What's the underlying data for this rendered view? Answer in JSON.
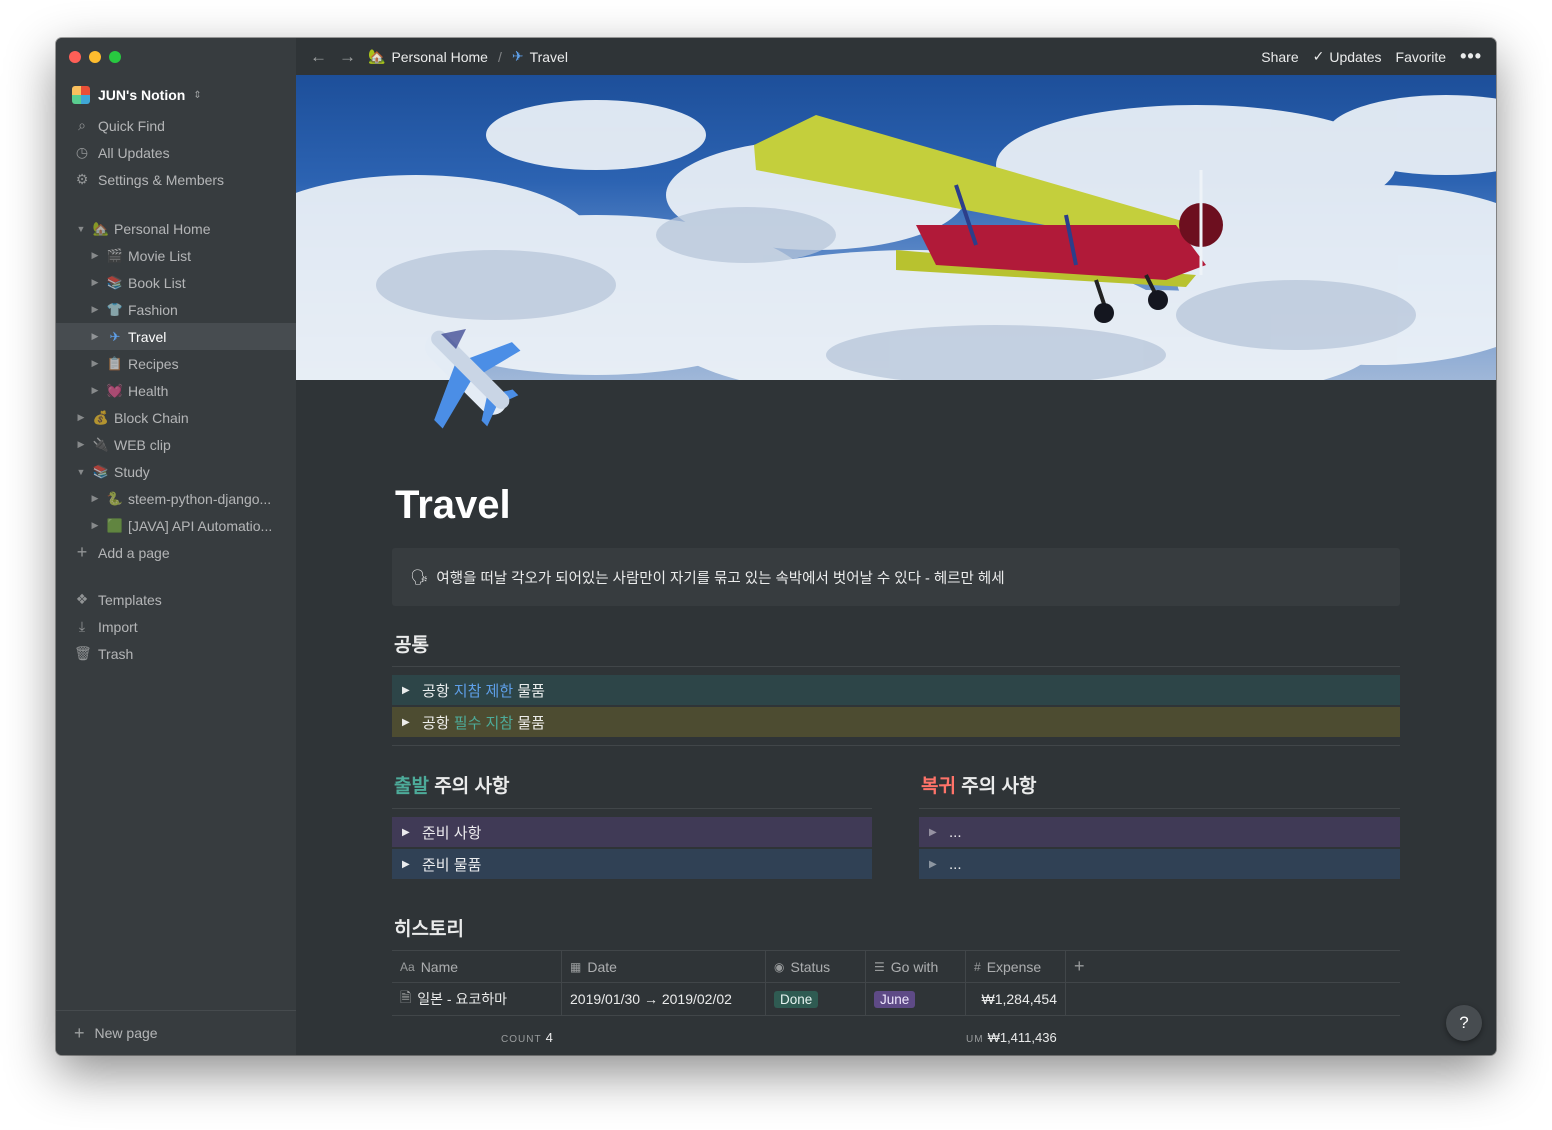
{
  "window": {
    "traffic_lights": [
      "close",
      "minimize",
      "zoom"
    ]
  },
  "sidebar": {
    "workspace": {
      "name": "JUN's Notion",
      "chevron": "⌃"
    },
    "top_items": [
      {
        "label": "Quick Find",
        "icon": "search-icon"
      },
      {
        "label": "All Updates",
        "icon": "clock-icon"
      },
      {
        "label": "Settings & Members",
        "icon": "gear-icon"
      }
    ],
    "tree": [
      {
        "label": "Personal Home",
        "emoji": "🏡",
        "expanded": true,
        "depth": 0
      },
      {
        "label": "Movie List",
        "emoji": "🎬",
        "depth": 1
      },
      {
        "label": "Book List",
        "emoji": "📚",
        "depth": 1
      },
      {
        "label": "Fashion",
        "emoji": "👕",
        "depth": 1
      },
      {
        "label": "Travel",
        "emoji": "✈",
        "depth": 1,
        "active": true
      },
      {
        "label": "Recipes",
        "emoji": "📋",
        "depth": 1
      },
      {
        "label": "Health",
        "emoji": "💓",
        "depth": 1
      },
      {
        "label": "Block Chain",
        "emoji": "💰",
        "depth": 0
      },
      {
        "label": "WEB clip",
        "emoji": "🔌",
        "depth": 0
      },
      {
        "label": "Study",
        "emoji": "📚",
        "expanded": true,
        "depth": 0
      },
      {
        "label": "steem-python-django...",
        "emoji": "🐍",
        "depth": 1
      },
      {
        "label": "[JAVA] API Automatio...",
        "emoji": "🟩",
        "depth": 1
      }
    ],
    "add_page": "Add a page",
    "bottom_items": [
      {
        "label": "Templates",
        "icon": "templates-icon"
      },
      {
        "label": "Import",
        "icon": "import-icon"
      },
      {
        "label": "Trash",
        "icon": "trash-icon"
      }
    ],
    "new_page": "New page"
  },
  "topbar": {
    "breadcrumb": [
      {
        "label": "Personal Home",
        "emoji": "🏡"
      },
      {
        "label": "Travel",
        "emoji": "✈"
      }
    ],
    "separator": "/",
    "actions": {
      "share": "Share",
      "updates": "Updates",
      "favorite": "Favorite",
      "more": "•••"
    }
  },
  "page": {
    "title": "Travel",
    "callout": {
      "emoji": "🗣",
      "text": "여행을 떠날 각오가 되어있는 사람만이 자기를 묶고 있는 속박에서 벗어날 수 있다 - 헤르만 헤세"
    },
    "common": {
      "heading": "공통",
      "toggles": [
        {
          "pre": "공항 ",
          "highlight": "지참 제한",
          "post": " 물품",
          "color": "#5e9fe8",
          "bg": "#2d4548"
        },
        {
          "pre": "공항 ",
          "highlight": "필수 지참",
          "post": " 물품",
          "color": "#4dab9a",
          "bg": "#4d4c31"
        }
      ]
    },
    "departure": {
      "heading_colored": "출발",
      "heading_rest": " 주의 사항",
      "color": "#4dab9a",
      "toggles": [
        "준비 사항",
        "준비 물품"
      ]
    },
    "return": {
      "heading_colored": "복귀",
      "heading_rest": " 주의 사항",
      "color": "#ff7369",
      "toggles": [
        "...",
        "..."
      ]
    },
    "history": {
      "heading": "히스토리",
      "columns": [
        {
          "label": "Name",
          "icon": "Aa"
        },
        {
          "label": "Date",
          "icon": "calendar-icon"
        },
        {
          "label": "Status",
          "icon": "select-icon"
        },
        {
          "label": "Go with",
          "icon": "list-icon"
        },
        {
          "label": "Expense",
          "icon": "hash-icon"
        }
      ],
      "add_column": "+",
      "rows": [
        {
          "name": "일본 - 요코하마",
          "date": "2019/01/30 → 2019/02/02",
          "status": "Done",
          "go_with": "June",
          "expense": "₩1,284,454"
        }
      ],
      "footer": {
        "count_label": "COUNT",
        "count": "4",
        "sum_label": "UM",
        "sum": "₩1,411,436"
      }
    }
  },
  "help": "?"
}
